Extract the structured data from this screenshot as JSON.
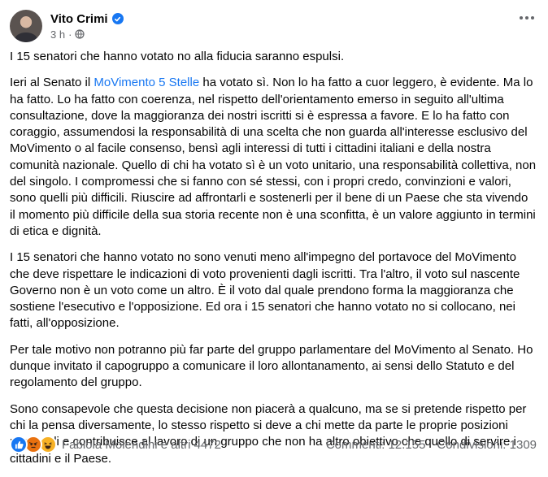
{
  "post": {
    "author": "Vito Crimi",
    "time": "3 h",
    "privacy_icon": "globe-icon",
    "paragraph_1": "I 15 senatori che hanno votato no alla fiducia saranno espulsi.",
    "paragraph_2_before_link": "Ieri al Senato il ",
    "paragraph_2_link": "MoVimento 5 Stelle",
    "paragraph_2_after_link": " ha votato sì. Non lo ha fatto a cuor leggero, è evidente. Ma lo ha fatto. Lo ha fatto con coerenza, nel rispetto dell'orientamento emerso in seguito all'ultima consultazione, dove la maggioranza dei nostri iscritti si è espressa a favore. E lo ha fatto con coraggio, assumendosi la responsabilità di una scelta che non guarda all'interesse esclusivo del MoVimento o al facile consenso, bensì agli interessi di tutti i cittadini italiani e della nostra comunità nazionale. Quello di chi ha votato sì è un voto unitario, una responsabilità collettiva, non del singolo. I compromessi che si fanno con sé stessi, con i propri credo, convinzioni e valori, sono quelli più difficili. Riuscire ad affrontarli e sostenerli per il bene di un Paese che sta vivendo il momento più difficile della sua storia recente non è una sconfitta, è un valore aggiunto in termini di etica e dignità.",
    "paragraph_3": "I 15 senatori che hanno votato no sono venuti meno all'impegno del portavoce del MoVimento che deve rispettare le indicazioni di voto provenienti dagli iscritti. Tra l'altro, il voto sul nascente Governo non è un voto come un altro. È il voto dal quale prendono forma la maggioranza che sostiene l'esecutivo e l'opposizione. Ed ora i 15 senatori che hanno votato no si collocano, nei fatti, all'opposizione.",
    "paragraph_4": "Per tale motivo non potranno più far parte del gruppo parlamentare del MoVimento al Senato. Ho dunque invitato il capogruppo a comunicare il loro allontanamento, ai sensi dello Statuto e del regolamento del gruppo.",
    "paragraph_5": "Sono consapevole che questa decisione non piacerà a qualcuno, ma se si pretende rispetto per chi la pensa diversamente, lo stesso rispetto si deve a chi mette da parte le proprie posizioni personali e contribuisce al lavoro di un gruppo che non ha altro obiettivo che quello di servire i cittadini e il Paese."
  },
  "footer": {
    "reactions": [
      "like-icon",
      "angry-icon",
      "haha-icon"
    ],
    "reactions_label": "Fabiola Molendini e altri 4472",
    "comments": "Commenti: 12.155",
    "shares": "Condivisioni: 1309"
  },
  "colors": {
    "link": "#1877f2",
    "secondary_text": "#65676b",
    "like": "#1877f2",
    "angry": "#e9710f",
    "haha": "#f7b125"
  }
}
